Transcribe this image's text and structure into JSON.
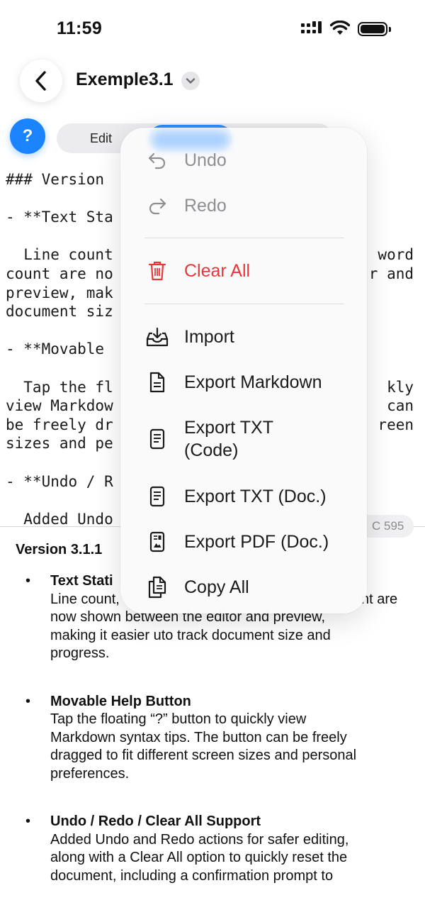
{
  "status_bar": {
    "time": "11:59"
  },
  "nav": {
    "title": "Exemple3.1"
  },
  "help_button": {
    "label": "?"
  },
  "segment": {
    "edit_label": "Edit"
  },
  "editor": {
    "lines": [
      "### Version",
      "",
      "- **Text Sta",
      "",
      "  Line count",
      "count are no",
      "preview, mak",
      "document siz",
      "",
      "- **Movable",
      "",
      "  Tap the fl",
      "view Markdow",
      "be freely dr",
      "sizes and pe",
      "",
      "- **Undo / R",
      "",
      "  Added Undo"
    ],
    "right_fragments": [
      "word",
      "r and",
      "kly",
      "can",
      "reen"
    ]
  },
  "stats": {
    "text": "C 595"
  },
  "preview": {
    "heading": "Version 3.1.1",
    "items": [
      {
        "title": "Text Stati",
        "body_lines": [
          "Line count,",
          "now shown between the editor and preview,",
          "making it easier uto track document size and",
          "progress."
        ],
        "right_fragment": "nt are"
      },
      {
        "title": "Movable Help Button",
        "body_lines": [
          "Tap the floating “?” button to quickly view",
          "Markdown syntax tips. The button can be freely",
          "dragged to fit different screen sizes and personal",
          "preferences."
        ]
      },
      {
        "title": "Undo / Redo / Clear All Support",
        "body_lines": [
          "Added Undo and Redo actions for safer editing,",
          "along with a Clear All option to quickly reset the",
          "document, including a confirmation prompt to"
        ]
      }
    ]
  },
  "menu": {
    "items": [
      {
        "label": "Undo",
        "icon": "undo-icon",
        "state": "disabled"
      },
      {
        "label": "Redo",
        "icon": "redo-icon",
        "state": "disabled"
      },
      {
        "label": "Clear All",
        "icon": "trash-icon",
        "state": "destructive"
      },
      {
        "label": "Import",
        "icon": "tray-download-icon",
        "state": "normal"
      },
      {
        "label": "Export Markdown",
        "icon": "document-icon",
        "state": "normal"
      },
      {
        "label": "Export TXT",
        "label_line2": "(Code)",
        "icon": "text-document-icon",
        "state": "normal"
      },
      {
        "label": "Export TXT (Doc.)",
        "icon": "text-document-icon",
        "state": "normal"
      },
      {
        "label": "Export PDF (Doc.)",
        "icon": "pdf-document-icon",
        "state": "normal"
      },
      {
        "label": "Copy All",
        "icon": "copy-documents-icon",
        "state": "normal"
      }
    ]
  },
  "colors": {
    "accent": "#1a84ff",
    "destructive": "#e5383b",
    "disabled": "#8e8e93"
  }
}
